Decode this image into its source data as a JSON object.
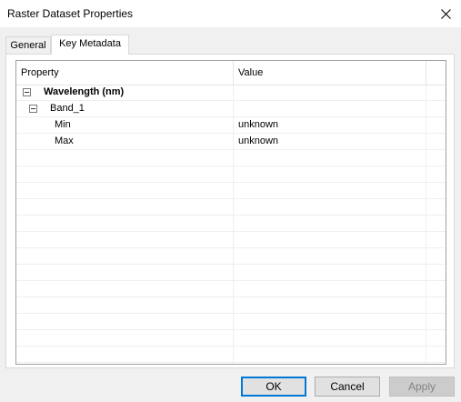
{
  "window": {
    "title": "Raster Dataset Properties"
  },
  "tabs": [
    {
      "label": "General",
      "active": false
    },
    {
      "label": "Key Metadata",
      "active": true
    }
  ],
  "grid": {
    "columns": [
      "Property",
      "Value"
    ],
    "rows": [
      {
        "property": "Wavelength (nm)",
        "value": "",
        "bold": true,
        "expanded": true
      },
      {
        "property": "Band_1",
        "value": "",
        "bold": false,
        "expanded": true
      },
      {
        "property": "Min",
        "value": "unknown",
        "bold": false
      },
      {
        "property": "Max",
        "value": "unknown",
        "bold": false
      }
    ]
  },
  "buttons": {
    "ok": "OK",
    "cancel": "Cancel",
    "apply": "Apply"
  },
  "icons": {
    "close": "close-icon",
    "expander": "minus-box-icon"
  },
  "colors": {
    "accent": "#0078d7",
    "window_bg": "#f0f0f0",
    "panel_bg": "#ffffff"
  }
}
